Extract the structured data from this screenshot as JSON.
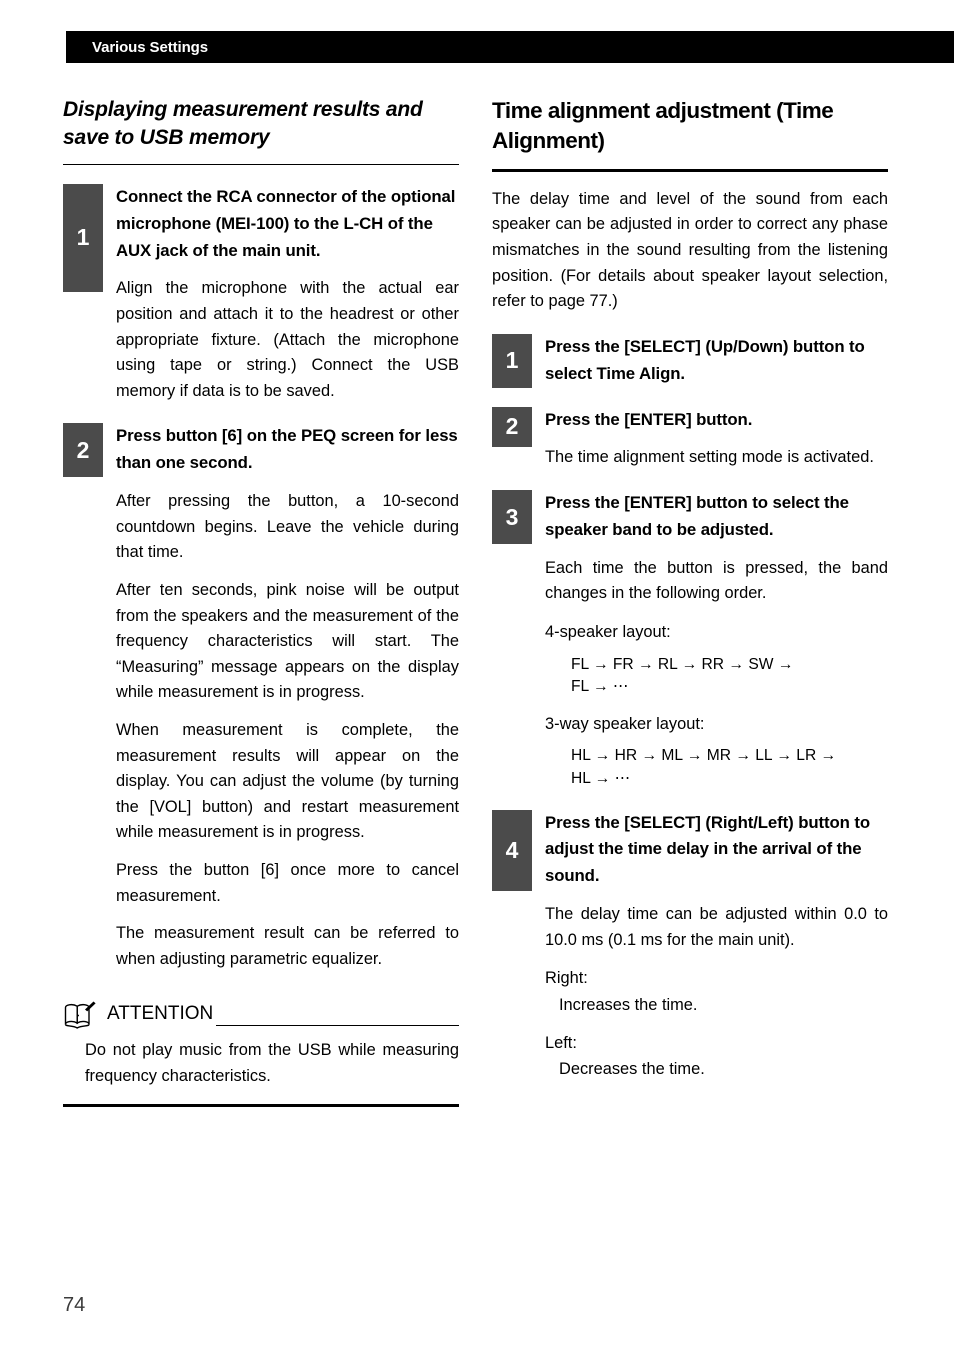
{
  "header": {
    "title": "Various Settings"
  },
  "footer": {
    "page_number": "74"
  },
  "colors": {
    "header_bar": "#000000",
    "step_badge": "#4b4b4b",
    "text": "#000000",
    "page_number": "#3b3b3b"
  },
  "left_column": {
    "heading": "Displaying measurement results and save to USB memory",
    "steps": [
      {
        "number": "1",
        "title": "Connect the RCA connector of the optional microphone (MEI-100) to the L-CH of the AUX jack of the main unit.",
        "paragraphs": [
          "Align the microphone with the actual ear position and attach it to the headrest or other appropriate fixture. (Attach the microphone using tape or string.) Connect the USB memory if data is to be saved."
        ]
      },
      {
        "number": "2",
        "title": "Press button [6] on the PEQ screen for less than one second.",
        "paragraphs": [
          "After pressing the button, a 10-second countdown begins. Leave the vehicle during that time.",
          "After ten seconds, pink noise will be output from the speakers and the measurement of the frequency characteristics will start. The “Measuring” message appears on the display while measurement is in progress.",
          "When measurement is complete, the measurement results will appear on the display. You can adjust the volume (by turning the [VOL] button) and restart measurement while measurement is in progress.",
          "Press the button [6] once more to cancel measurement.",
          "The measurement result can be referred to when adjusting parametric equalizer."
        ]
      }
    ],
    "attention": {
      "icon": "open-book-icon",
      "title": "ATTENTION",
      "text": "Do not play music from the USB while measuring frequency characteristics."
    }
  },
  "right_column": {
    "heading": "Time alignment adjustment (Time Alignment)",
    "intro": "The delay time and level of the sound from each speaker can be adjusted in order to correct any phase mismatches in the sound resulting from the listening position. (For details about speaker layout selection, refer to page 77.)",
    "steps": [
      {
        "number": "1",
        "title": "Press the [SELECT] (Up/Down) button to select Time Align."
      },
      {
        "number": "2",
        "title": "Press the [ENTER] button.",
        "paragraphs": [
          "The time alignment setting mode is activated."
        ]
      },
      {
        "number": "3",
        "title": "Press the [ENTER] button to select the speaker band to be adjusted.",
        "paragraphs": [
          "Each time the button is pressed, the band changes in the following order."
        ],
        "sequences": [
          {
            "label": "4-speaker layout:",
            "line1": "FL → FR → RL → RR → SW →",
            "line2": "FL → ⋯"
          },
          {
            "label": "3-way speaker layout:",
            "line1": "HL → HR → ML → MR → LL → LR →",
            "line2": "HL → ⋯"
          }
        ]
      },
      {
        "number": "4",
        "title": "Press the [SELECT] (Right/Left) button to adjust the time delay in the arrival of the sound.",
        "paragraphs": [
          "The delay time can be adjusted within 0.0 to 10.0 ms (0.1 ms for the main unit)."
        ],
        "directions": [
          {
            "label": "Right:",
            "value": "Increases the time."
          },
          {
            "label": "Left:",
            "value": "Decreases the time."
          }
        ]
      }
    ]
  }
}
